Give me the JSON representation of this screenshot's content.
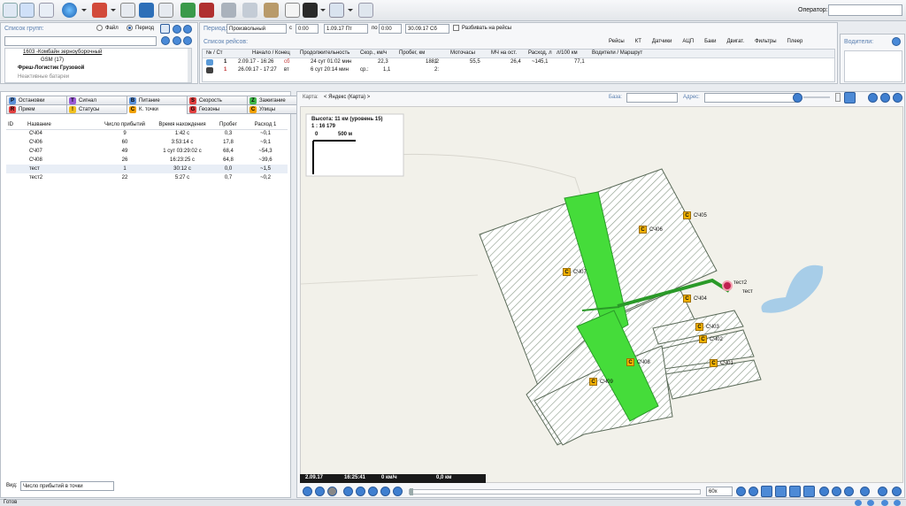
{
  "operator": {
    "label": "Оператор:",
    "value": ""
  },
  "groups": {
    "title": "Список групп:",
    "radio_file": "Файл",
    "radio_period": "Период",
    "tree": [
      "1603 -Комбайн зерноуборочный",
      "GSM (17)",
      "Фреш-Логистик Грузовой",
      "Неактивные батареи"
    ]
  },
  "period": {
    "label": "Период:",
    "value": "Произвольный",
    "from_label": "с",
    "from_time": "0:00",
    "from_date": "1.09.17 Пт",
    "to_label": "по",
    "to_time": "0:00",
    "to_date": "30.09.17 Сб",
    "split_label": "Разбивать на рейсы"
  },
  "trips": {
    "title": "Список рейсов:",
    "tabs": [
      "Рейсы",
      "КТ",
      "Датчики",
      "АЦП",
      "Баки",
      "Двигат.",
      "Фильтры",
      "Плеер"
    ],
    "columns": [
      "№ / Ст",
      "Начало / Конец",
      "Продолжительность",
      "Скор., км/ч",
      "Пробег, км",
      "Моточасы",
      "МЧ на ост.",
      "Расход, л",
      "л/100 км",
      "Водители / Маршрут"
    ],
    "row1": [
      "1",
      "2.09.17 - 16:26",
      "сб",
      "24 сут 01:02 мин",
      "22,3",
      "188,2",
      "1:",
      "55,5",
      "26,4",
      "~145,1",
      "77,1"
    ],
    "row2": [
      "1",
      "26.09.17 - 17:27",
      "вт",
      "6 сут 20:14 мин",
      "ср.:",
      "1,1",
      "2:"
    ]
  },
  "drivers": {
    "title": "Водители:"
  },
  "tabs_row1": [
    {
      "label": "Остановки",
      "color": "#5a90d8",
      "icon": "P"
    },
    {
      "label": "Сигнал",
      "color": "#9a5ad8",
      "icon": "T"
    },
    {
      "label": "Питание",
      "color": "#5a90d8",
      "icon": "B"
    },
    {
      "label": "Скорость",
      "color": "#e04040",
      "icon": "S"
    },
    {
      "label": "Зажигание",
      "color": "#3fb84a",
      "icon": "Z"
    }
  ],
  "tabs_row2": [
    {
      "label": "Прием",
      "color": "#e04040",
      "icon": "R"
    },
    {
      "label": "Статусы",
      "color": "#f0c020",
      "icon": "!"
    },
    {
      "label": "К. точки",
      "color": "#f0a000",
      "icon": "C"
    },
    {
      "label": "Геозоны",
      "color": "#e04040",
      "icon": "G"
    },
    {
      "label": "Улицы",
      "color": "#f0a000",
      "icon": "C"
    }
  ],
  "kt": {
    "columns": [
      "ID",
      "Название",
      "Число прибытий",
      "Время нахождения",
      "Пробег",
      "Расход 1"
    ],
    "rows": [
      [
        "",
        "СЧ04",
        "9",
        "1:42 с",
        "0,3",
        "~0,1"
      ],
      [
        "",
        "СЧ06",
        "60",
        "3:53:14 с",
        "17,8",
        "~9,1"
      ],
      [
        "",
        "СЧ07",
        "49",
        "1 сут 03:29:02 с",
        "68,4",
        "~54,3"
      ],
      [
        "",
        "СЧ08",
        "26",
        "16:23:25 с",
        "64,8",
        "~39,6"
      ],
      [
        "",
        "тест",
        "1",
        "30:12 с",
        "0,0",
        "~1,5"
      ],
      [
        "",
        "тест2",
        "22",
        "5:27 с",
        "0,7",
        "~0,2"
      ]
    ]
  },
  "view": {
    "label": "Вид:",
    "value": "Число прибытий в точки"
  },
  "map": {
    "label": "Карта:",
    "name": "< Яндекс (Карта) >",
    "base_label": "База:",
    "address_label": "Адрес:",
    "height_text": "Высота: 11 км (уровень 15)",
    "scale_text": "1 : 16 179",
    "scale_zero": "0",
    "scale_dist": "500 м",
    "info_date": "2.09.17",
    "info_time": "16:25:41",
    "info_speed": "0 км/ч",
    "info_dist": "0,0 км",
    "zoom": "60x",
    "points": [
      "СЧ05",
      "СЧ06",
      "СЧ07",
      "СЧ04",
      "СЧ03",
      "СЧ02",
      "СЧ01",
      "СЧ08",
      "СЧ09",
      "тест2",
      "тест"
    ]
  },
  "status": "Готов"
}
